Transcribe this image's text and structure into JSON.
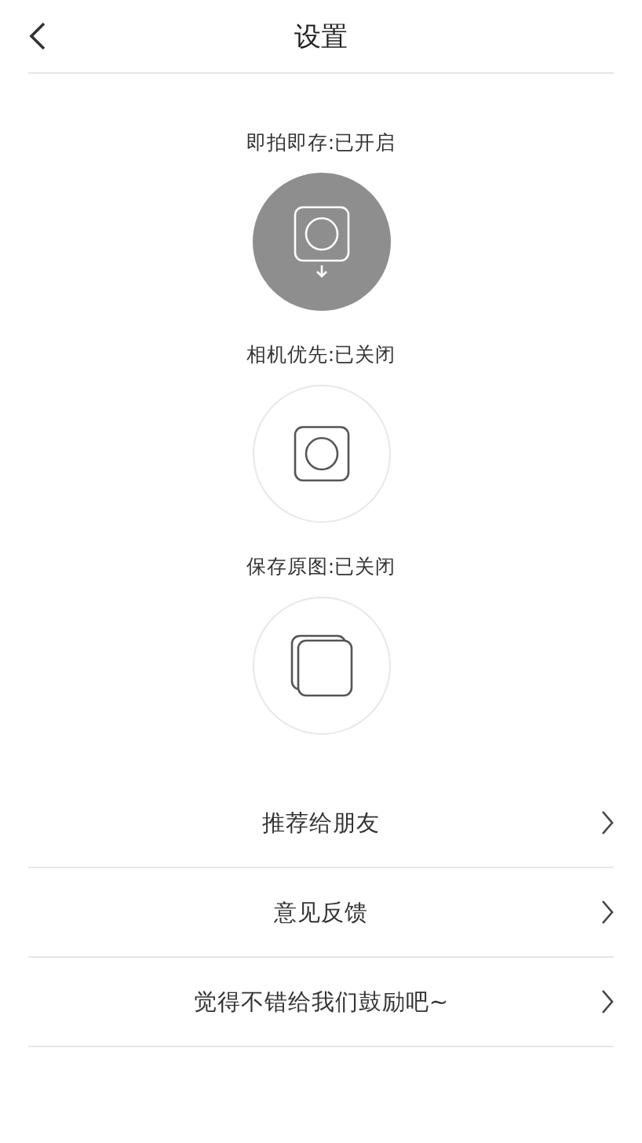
{
  "header": {
    "title": "设置"
  },
  "toggles": [
    {
      "label": "即拍即存:已开启",
      "kind": "capture",
      "on": true
    },
    {
      "label": "相机优先:已关闭",
      "kind": "camera",
      "on": false
    },
    {
      "label": "保存原图:已关闭",
      "kind": "original",
      "on": false
    }
  ],
  "menu": [
    {
      "label": "推荐给朋友"
    },
    {
      "label": "意见反馈"
    },
    {
      "label": "觉得不错给我们鼓励吧~"
    }
  ]
}
